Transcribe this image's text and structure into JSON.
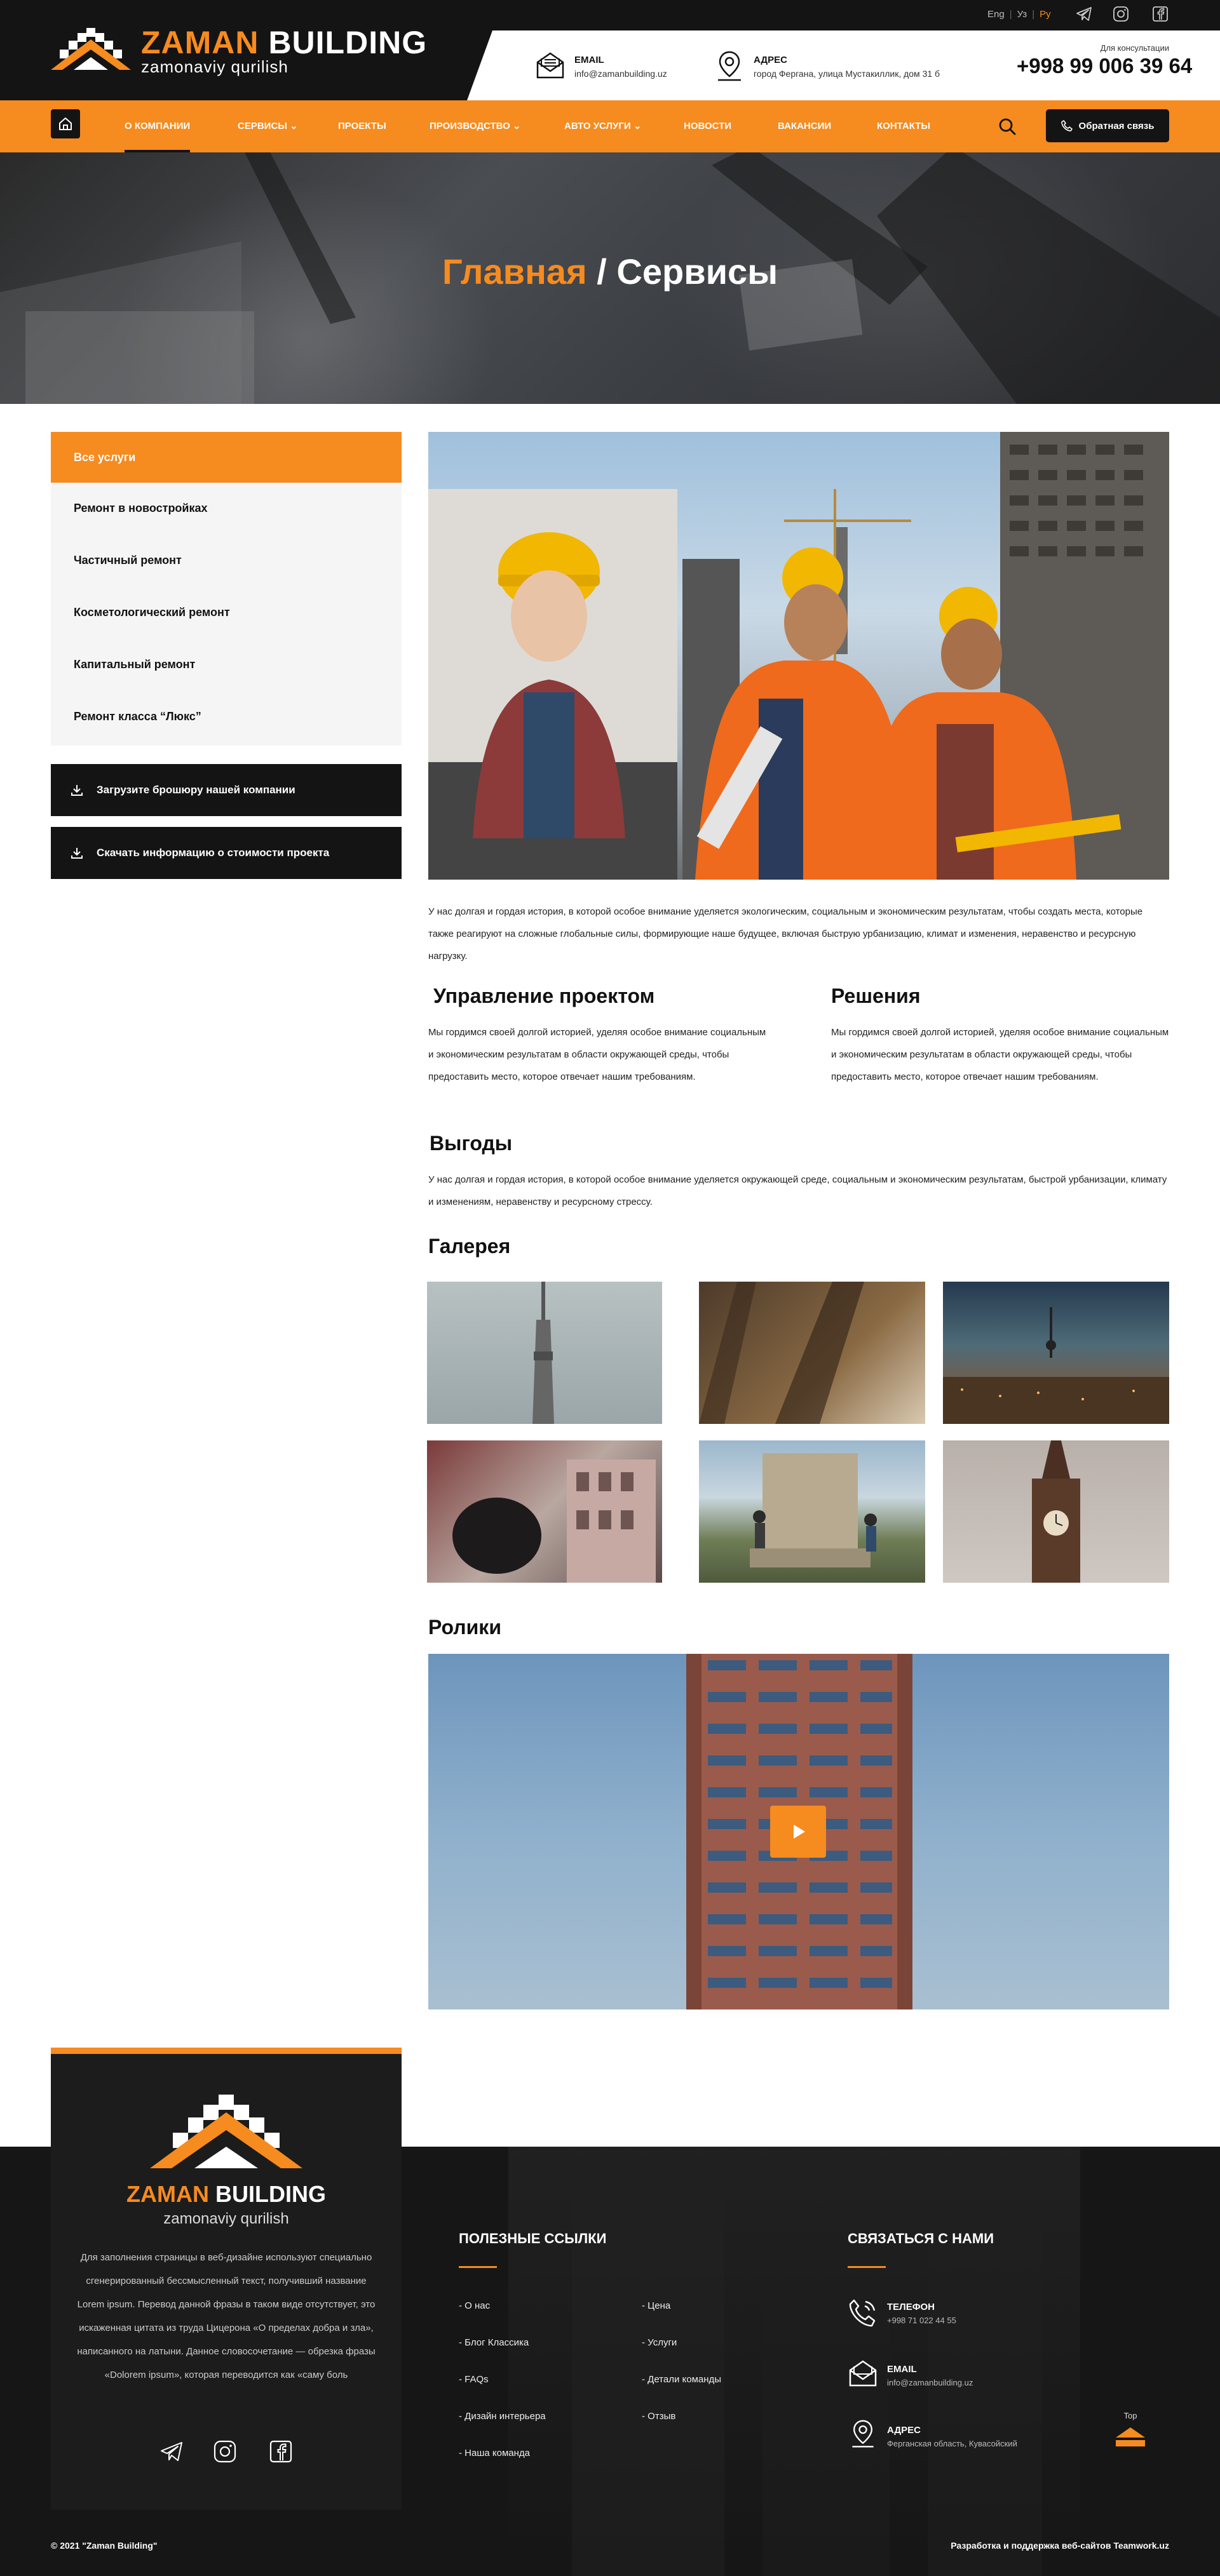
{
  "brand": {
    "name_orange": "ZAMAN",
    "name_white": "BUILDING",
    "tagline": "zamonaviy qurilish"
  },
  "langs": {
    "eng": "Eng",
    "uz": "Уз",
    "ru": "Ру"
  },
  "header": {
    "email": {
      "label": "EMAIL",
      "value": "info@zamanbuilding.uz"
    },
    "address": {
      "label": "АДРЕС",
      "value": "город Фергана, улица Мустакиллик, дом 31 б"
    },
    "consult": {
      "label": "Для консультации",
      "phone": "+998 99 006 39 64"
    }
  },
  "nav": {
    "items": [
      "О КОМПАНИИ",
      "СЕРВИСЫ",
      "ПРОЕКТЫ",
      "ПРОИЗВОДСТВО",
      "АВТО УСЛУГИ",
      "НОВОСТИ",
      "ВАКАНСИИ",
      "КОНТАКТЫ"
    ],
    "dropdown_marker": "⌄",
    "feedback": "Обратная связь"
  },
  "hero": {
    "crumb_home": "Главная",
    "separator": " / ",
    "crumb_current": "Сервисы"
  },
  "sidebar": {
    "items": [
      "Все услуги",
      "Ремонт в новостройках",
      "Частичный ремонт",
      "Косметологический ремонт",
      "Капитальный ремонт",
      "Ремонт класса “Люкс”"
    ]
  },
  "downloads": {
    "brochure": "Загрузите брошюру нашей компании",
    "cost": "Скачать информацию о стоимости проекта"
  },
  "content": {
    "intro": "У нас долгая и гордая история, в которой особое внимание уделяется экологическим, социальным и экономическим результатам, чтобы создать места, которые также реагируют на сложные глобальные силы, формирующие наше будущее, включая быструю урбанизацию, климат и изменения, неравенство и ресурсную нагрузку.",
    "pm_title": "Управление проектом",
    "pm_text": "Мы гордимся своей долгой историей, уделяя особое внимание социальным и экономическим результатам в области окружающей среды, чтобы предоставить место, которое отвечает нашим требованиям.",
    "sol_title": "Решения",
    "sol_text": "Мы гордимся своей долгой историей, уделяя особое внимание социальным и экономическим результатам в области окружающей среды, чтобы предоставить место, которое отвечает нашим требованиям.",
    "benefits_title": "Выгоды",
    "benefits_text": "У нас долгая и гордая история, в которой особое внимание уделяется окружающей среде, социальным и экономическим результатам, быстрой урбанизации, климату и изменениям, неравенству и ресурсному стрессу.",
    "gallery_title": "Галерея",
    "videos_title": "Ролики"
  },
  "footer": {
    "about": "Для заполнения страницы в веб-дизайне используют специально сгенерированный бессмысленный текст, получивший название Lorem ipsum. Перевод данной фразы в таком виде отсутствует, это искаженная цитата из труда Цицерона «О пределах добра и зла», написанного на латыни. Данное словосочетание — обрезка фразы «Dolorem ipsum», которая переводится как «саму боль",
    "links_title": "ПОЛЕЗНЫЕ ССЫЛКИ",
    "links_col1": [
      "- О нас",
      "- Блог Классика",
      "- FAQs",
      "- Дизайн интерьера",
      "- Наша команда"
    ],
    "links_col2": [
      "- Цена",
      "- Услуги",
      "- Детали команды",
      "- Отзыв"
    ],
    "contact_title": "СВЯЗАТЬСЯ С НАМИ",
    "phone": {
      "label": "ТЕЛЕФОН",
      "value": "+998 71 022 44 55"
    },
    "email": {
      "label": "EMAIL",
      "value": "info@zamanbuilding.uz"
    },
    "address": {
      "label": "АДРЕС",
      "value": "Ферганская область, Кувасойский"
    },
    "top": "Top",
    "copyright": "© 2021 \"Zaman Building\"",
    "madeby": "Разработка и поддержка веб-сайтов Teamwork.uz"
  },
  "colors": {
    "accent": "#f68b1f",
    "dark": "#141414"
  }
}
